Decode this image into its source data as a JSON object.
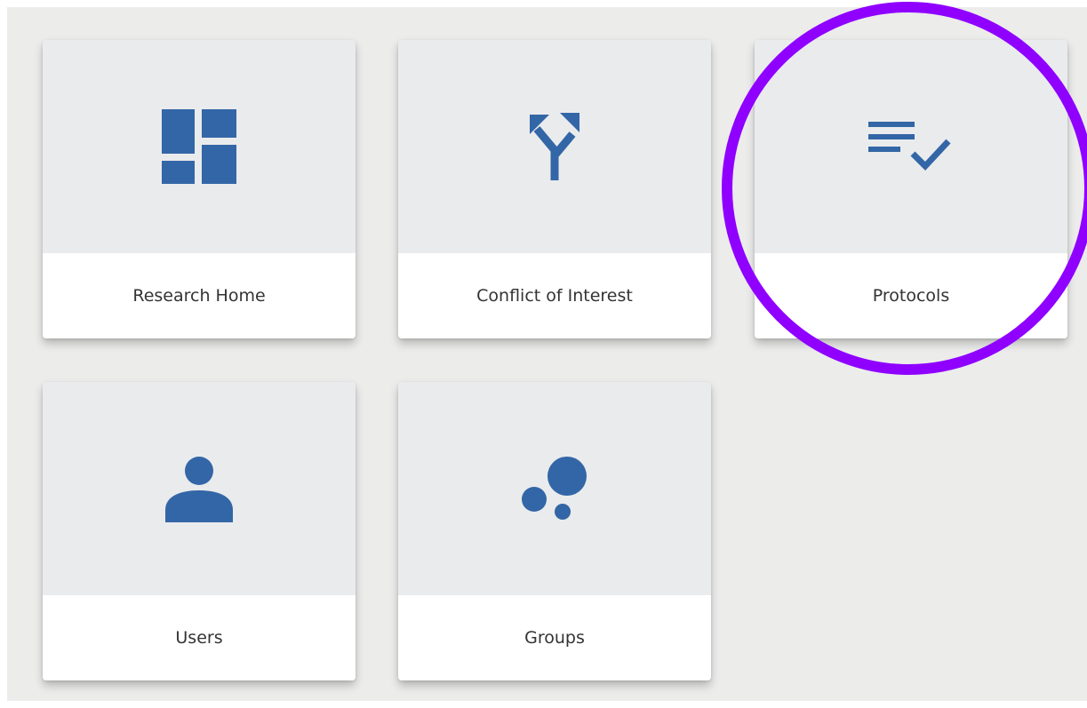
{
  "colors": {
    "icon": "#3366a6",
    "canvas_background": "#ececeb",
    "tile_top": "#eaebed",
    "tile_bottom": "#ffffff",
    "label": "#333333",
    "highlight": "#8f00ff"
  },
  "tiles": [
    {
      "label": "Research Home",
      "icon": "dashboard-icon"
    },
    {
      "label": "Conflict of Interest",
      "icon": "fork-arrows-icon"
    },
    {
      "label": "Protocols",
      "icon": "list-check-icon"
    },
    {
      "label": "Users",
      "icon": "person-icon"
    },
    {
      "label": "Groups",
      "icon": "bubbles-icon"
    }
  ],
  "highlight": {
    "target": "Protocols",
    "shape": "circle"
  }
}
